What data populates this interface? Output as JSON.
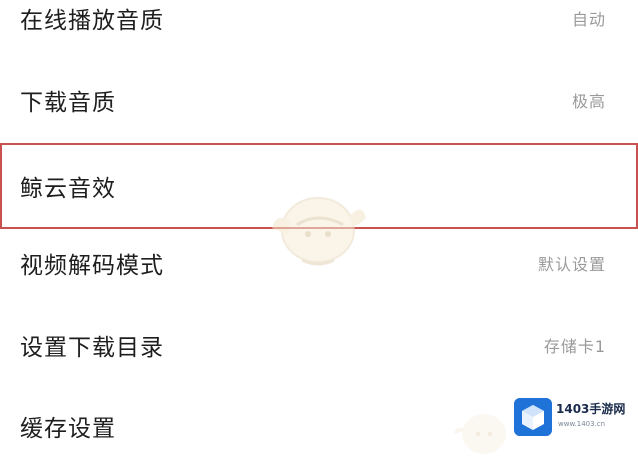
{
  "settings": {
    "items": [
      {
        "label": "在线播放音质",
        "value": "自动",
        "highlighted": false
      },
      {
        "label": "下载音质",
        "value": "极高",
        "highlighted": false
      },
      {
        "label": "鲸云音效",
        "value": "",
        "highlighted": true
      },
      {
        "label": "视频解码模式",
        "value": "默认设置",
        "highlighted": false
      },
      {
        "label": "设置下载目录",
        "value": "存储卡1",
        "highlighted": false
      },
      {
        "label": "缓存设置",
        "value": "",
        "highlighted": false
      }
    ]
  },
  "watermark": {
    "logo_text": "1403手游网",
    "logo_sub": "www.1403.cn",
    "icon": "cube-logo-icon",
    "accent_color": "#1f73d8",
    "highlight_color": "#c9514f"
  }
}
